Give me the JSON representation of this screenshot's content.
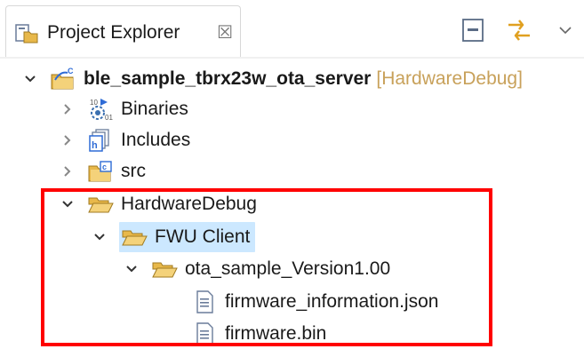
{
  "view": {
    "tab_title": "Project Explorer",
    "tab_close_glyph": "☒",
    "toolbar": [
      {
        "name": "collapse-all-icon"
      },
      {
        "name": "link-with-editor-icon"
      },
      {
        "name": "view-menu-icon"
      }
    ]
  },
  "tree": {
    "project": {
      "label": "ble_sample_tbrx23w_ota_server",
      "decoration": "[HardwareDebug]"
    },
    "items": [
      {
        "label": "Binaries"
      },
      {
        "label": "Includes"
      },
      {
        "label": "src"
      },
      {
        "label": "HardwareDebug"
      },
      {
        "label": "FWU Client"
      },
      {
        "label": "ota_sample_Version1.00"
      },
      {
        "label": "firmware_information.json"
      },
      {
        "label": "firmware.bin"
      }
    ]
  },
  "colors": {
    "folder": "#e8b84a",
    "selection": "#cce8ff",
    "highlight_box": "#ff0000",
    "decoration": "#c8a15a"
  }
}
